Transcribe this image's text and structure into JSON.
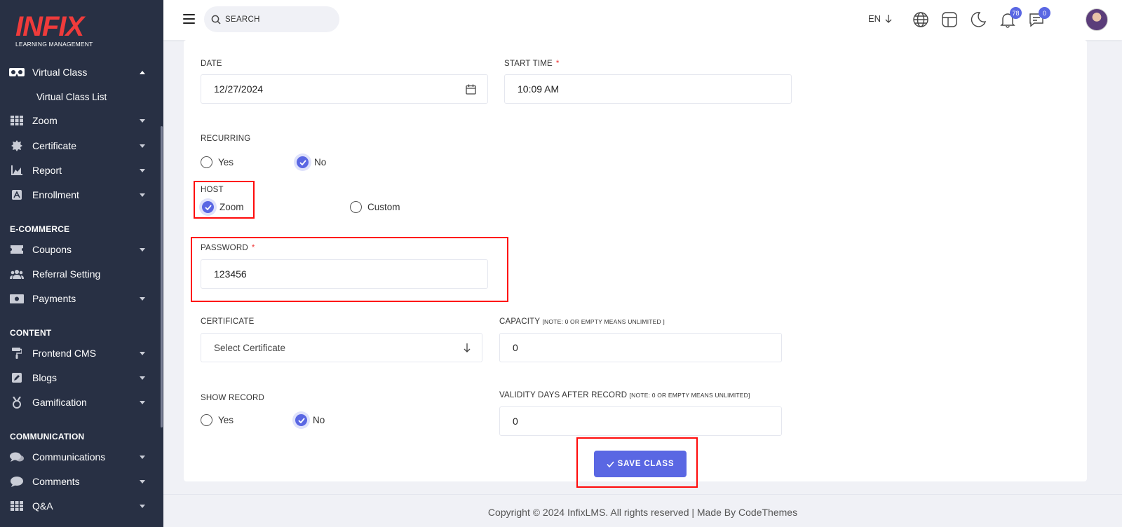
{
  "brand": {
    "logo_text": "INFIX",
    "logo_sub": "LEARNING MANAGEMENT"
  },
  "sidebar": {
    "active": {
      "label": "Virtual Class",
      "icon": "vr-headset-icon",
      "sub": "Virtual Class List"
    },
    "items": [
      {
        "label": "Zoom",
        "icon": "grid-icon"
      },
      {
        "label": "Certificate",
        "icon": "certificate-icon"
      },
      {
        "label": "Report",
        "icon": "area-chart-icon"
      },
      {
        "label": "Enrollment",
        "icon": "enrollment-icon"
      }
    ],
    "section_ecommerce": "E-COMMERCE",
    "ecommerce": [
      {
        "label": "Coupons",
        "icon": "ticket-icon"
      },
      {
        "label": "Referral Setting",
        "icon": "users-icon"
      },
      {
        "label": "Payments",
        "icon": "money-icon"
      }
    ],
    "section_content": "CONTENT",
    "content": [
      {
        "label": "Frontend CMS",
        "icon": "paint-roller-icon"
      },
      {
        "label": "Blogs",
        "icon": "edit-icon"
      },
      {
        "label": "Gamification",
        "icon": "medal-icon"
      }
    ],
    "section_communication": "COMMUNICATION",
    "communication": [
      {
        "label": "Communications",
        "icon": "chat-bubbles-icon"
      },
      {
        "label": "Comments",
        "icon": "comment-icon"
      },
      {
        "label": "Q&A",
        "icon": "grid-icon"
      }
    ]
  },
  "topbar": {
    "search_placeholder": "SEARCH",
    "language": "EN",
    "notifications_count": "78",
    "messages_count": "0"
  },
  "form": {
    "date_label": "DATE",
    "date_value": "12/27/2024",
    "start_time_label": "START TIME",
    "start_time_value": "10:09 AM",
    "required_mark": "*",
    "recurring_label": "RECURRING",
    "recurring_yes": "Yes",
    "recurring_no": "No",
    "host_label": "HOST",
    "host_zoom": "Zoom",
    "host_custom": "Custom",
    "password_label": "PASSWORD",
    "password_value": "123456",
    "certificate_label": "CERTIFICATE",
    "certificate_placeholder": "Select Certificate",
    "capacity_label": "CAPACITY",
    "capacity_note": "[NOTE: 0 OR EMPTY MEANS UNLIMITED ]",
    "capacity_value": "0",
    "show_record_label": "SHOW RECORD",
    "show_record_yes": "Yes",
    "show_record_no": "No",
    "validity_label": "VALIDITY DAYS AFTER RECORD",
    "validity_note": "[NOTE: 0 OR EMPTY MEANS UNLIMITED]",
    "validity_value": "0",
    "save_label": "SAVE CLASS"
  },
  "footer": {
    "text": "Copyright © 2024 InfixLMS. All rights reserved | Made By CodeThemes"
  },
  "colors": {
    "sidebar": "#283044",
    "accent": "#5a67e3",
    "highlight": "#ff0a0a",
    "logo": "#ef3b3b"
  }
}
